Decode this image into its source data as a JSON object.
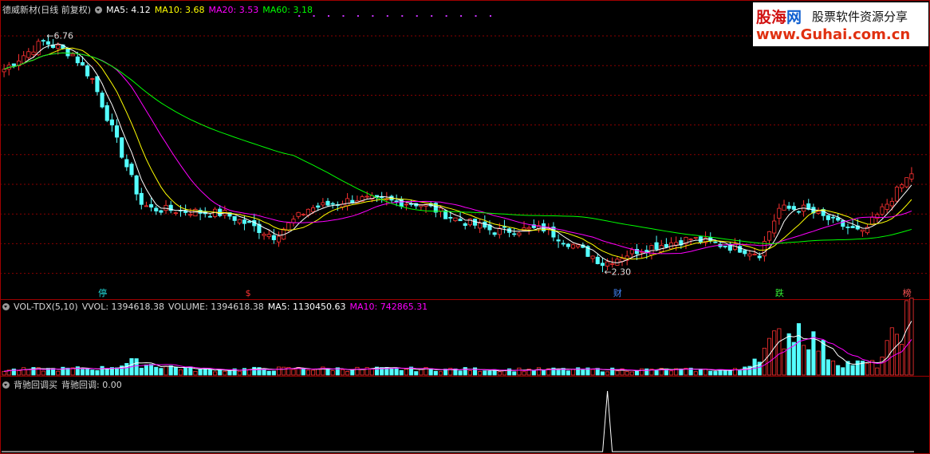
{
  "main_header": {
    "stock_title": "德威新材(日线 前复权)",
    "ma5": "MA5: 4.12",
    "ma10": "MA10: 3.68",
    "ma20": "MA20: 3.53",
    "ma60": "MA60: 3.18"
  },
  "vol_header": {
    "name": "VOL-TDX(5,10)",
    "vvol": "VVOL: 1394618.38",
    "volume": "VOLUME: 1394618.38",
    "ma5": "MA5: 1130450.63",
    "ma10": "MA10: 742865.31"
  },
  "ind_header": {
    "name": "背驰回调买",
    "value": "背驰回调: 0.00"
  },
  "price_labels": {
    "high": "6.76",
    "low": "2.30"
  },
  "event_markers": [
    {
      "label": "停",
      "color": "#22dddd",
      "bar": 20
    },
    {
      "label": "$",
      "color": "#ff3333",
      "bar": 50
    },
    {
      "label": "财",
      "color": "#4488ff",
      "bar": 125
    },
    {
      "label": "跌",
      "color": "#33ee33",
      "bar": 158
    },
    {
      "label": "榜",
      "color": "#ff5555",
      "bar": 184
    }
  ],
  "watermark": {
    "brand_a": "股海",
    "brand_b": "网",
    "slogan": "股票软件资源分享",
    "url": "www.Guhai.com.cn"
  },
  "colors": {
    "up": "#ff3232",
    "down": "#54ffff",
    "ma5": "#ffffff",
    "ma10": "#ffff00",
    "ma20": "#ff00ff",
    "ma60": "#00ff00",
    "grid": "#8b0000",
    "border": "#a00000"
  },
  "chart_data": [
    {
      "type": "candlestick",
      "title": "德威新材(日线 前复权)",
      "ylim": [
        1.6,
        7.3
      ],
      "key_points": [
        {
          "bar": 0,
          "close": 6.2
        },
        {
          "bar": 8,
          "close": 6.76
        },
        {
          "bar": 14,
          "close": 6.5
        },
        {
          "bar": 18,
          "close": 6.0
        },
        {
          "bar": 24,
          "close": 4.5
        },
        {
          "bar": 28,
          "close": 3.5
        },
        {
          "bar": 30,
          "close": 3.4
        },
        {
          "bar": 45,
          "close": 3.3
        },
        {
          "bar": 55,
          "close": 2.85
        },
        {
          "bar": 62,
          "close": 3.4
        },
        {
          "bar": 72,
          "close": 3.6
        },
        {
          "bar": 85,
          "close": 3.5
        },
        {
          "bar": 92,
          "close": 3.2
        },
        {
          "bar": 100,
          "close": 2.95
        },
        {
          "bar": 110,
          "close": 3.0
        },
        {
          "bar": 120,
          "close": 2.45
        },
        {
          "bar": 122,
          "close": 2.3
        },
        {
          "bar": 130,
          "close": 2.6
        },
        {
          "bar": 140,
          "close": 2.8
        },
        {
          "bar": 150,
          "close": 2.6
        },
        {
          "bar": 154,
          "close": 2.5
        },
        {
          "bar": 158,
          "close": 3.4
        },
        {
          "bar": 163,
          "close": 3.4
        },
        {
          "bar": 170,
          "close": 3.1
        },
        {
          "bar": 175,
          "close": 2.9
        },
        {
          "bar": 180,
          "close": 3.5
        },
        {
          "bar": 185,
          "close": 4.12
        }
      ],
      "series": [
        {
          "name": "MA5",
          "last": 4.12
        },
        {
          "name": "MA10",
          "last": 3.68
        },
        {
          "name": "MA20",
          "last": 3.53
        },
        {
          "name": "MA60",
          "last": 3.18
        }
      ],
      "high_label": 6.76,
      "low_label": 2.3
    },
    {
      "type": "bar",
      "title": "VOL-TDX(5,10)",
      "series": [
        {
          "name": "VOLUME",
          "last": 1394618.38
        },
        {
          "name": "MA5",
          "last": 1130450.63
        },
        {
          "name": "MA10",
          "last": 742865.31
        }
      ],
      "key_points": [
        {
          "bar": 0,
          "vol": 120000
        },
        {
          "bar": 20,
          "vol": 160000
        },
        {
          "bar": 26,
          "vol": 300000
        },
        {
          "bar": 40,
          "vol": 120000
        },
        {
          "bar": 60,
          "vol": 150000
        },
        {
          "bar": 100,
          "vol": 130000
        },
        {
          "bar": 150,
          "vol": 120000
        },
        {
          "bar": 158,
          "vol": 900000
        },
        {
          "bar": 162,
          "vol": 1150000
        },
        {
          "bar": 170,
          "vol": 300000
        },
        {
          "bar": 178,
          "vol": 250000
        },
        {
          "bar": 184,
          "vol": 1394618
        }
      ]
    },
    {
      "type": "line",
      "title": "背驰回调买",
      "series": [
        {
          "name": "背驰回调",
          "last": 0.0,
          "spike_bar": 123,
          "spike_value": 1
        }
      ]
    }
  ]
}
